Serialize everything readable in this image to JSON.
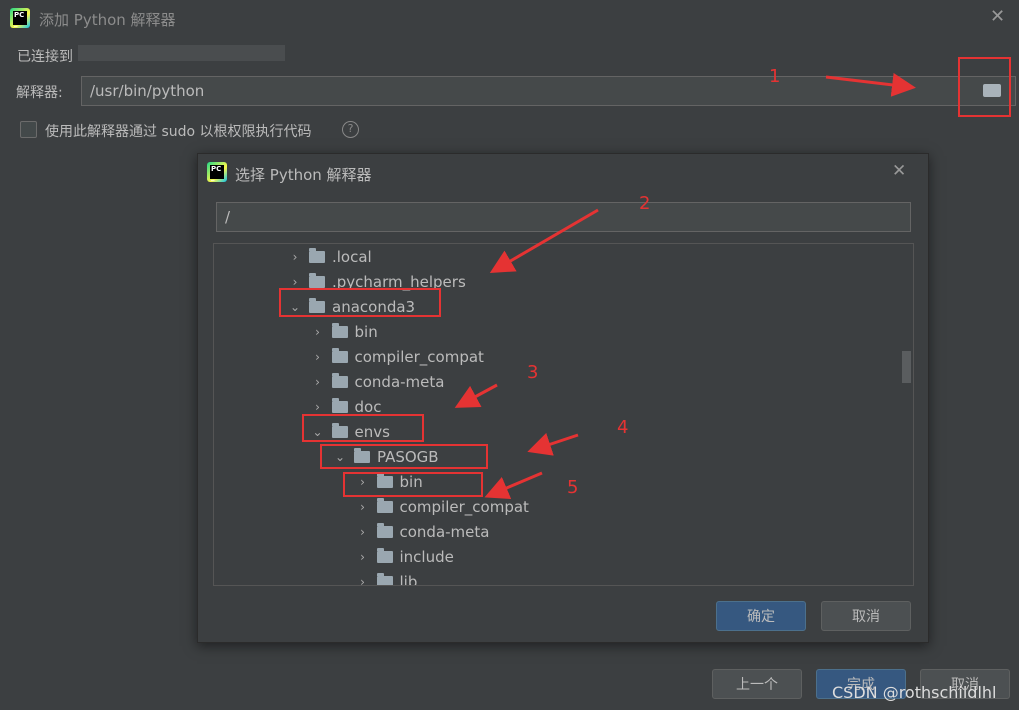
{
  "outer": {
    "title": "添加 Python 解释器",
    "connected_label": "已连接到",
    "interpreter_label": "解释器:",
    "interpreter_value": "/usr/bin/python",
    "sudo_label": "使用此解释器通过 sudo 以根权限执行代码",
    "buttons": {
      "prev": "上一个",
      "finish": "完成",
      "cancel": "取消"
    }
  },
  "inner": {
    "title": "选择 Python 解释器",
    "path_value": "/",
    "tree": [
      {
        "label": ".local",
        "level": 0,
        "expanded": false
      },
      {
        "label": ".pycharm_helpers",
        "level": 0,
        "expanded": false
      },
      {
        "label": "anaconda3",
        "level": 0,
        "expanded": true
      },
      {
        "label": "bin",
        "level": 1,
        "expanded": false
      },
      {
        "label": "compiler_compat",
        "level": 1,
        "expanded": false
      },
      {
        "label": "conda-meta",
        "level": 1,
        "expanded": false
      },
      {
        "label": "doc",
        "level": 1,
        "expanded": false
      },
      {
        "label": "envs",
        "level": 1,
        "expanded": true
      },
      {
        "label": "PASOGB",
        "level": 2,
        "expanded": true
      },
      {
        "label": "bin",
        "level": 3,
        "expanded": false
      },
      {
        "label": "compiler_compat",
        "level": 3,
        "expanded": false
      },
      {
        "label": "conda-meta",
        "level": 3,
        "expanded": false
      },
      {
        "label": "include",
        "level": 3,
        "expanded": false
      },
      {
        "label": "lib",
        "level": 3,
        "expanded": false
      }
    ],
    "buttons": {
      "ok": "确定",
      "cancel": "取消"
    }
  },
  "annotations": [
    "1",
    "2",
    "3",
    "4",
    "5"
  ],
  "watermark": "CSDN @rothschildlhl",
  "colors": {
    "annotation": "#e53333",
    "primary_button": "#365880"
  }
}
